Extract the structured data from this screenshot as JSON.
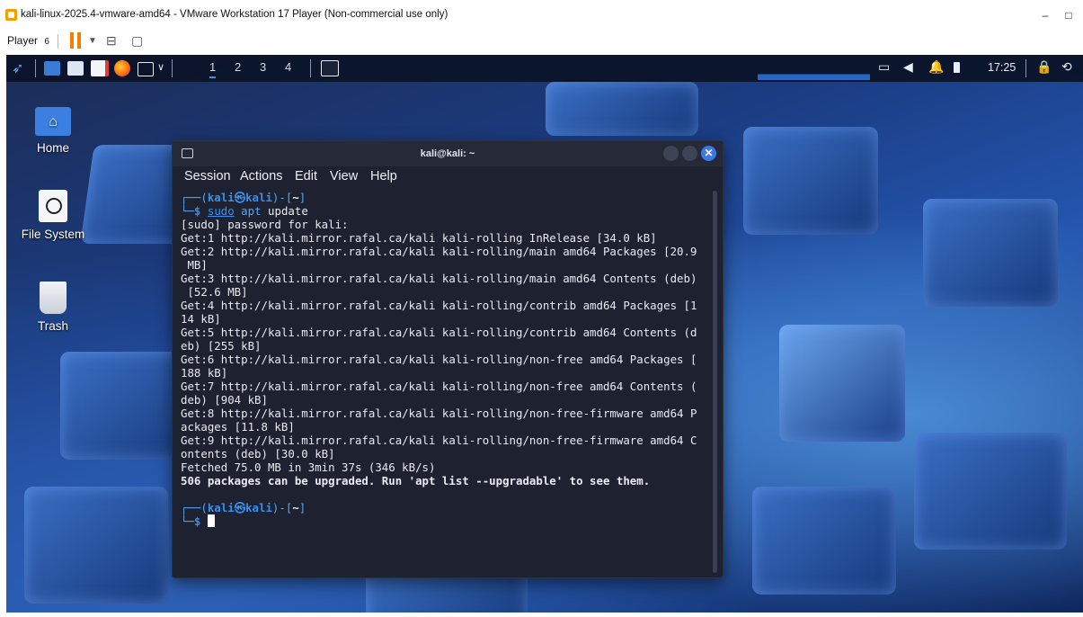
{
  "host": {
    "title": "kali-linux-2025.4-vmware-amd64 - VMware Workstation 17 Player (Non-commercial use only)",
    "minimize": "–",
    "maximize": "□"
  },
  "toolbar": {
    "player_label": "Player",
    "player_suffix": "6"
  },
  "panel": {
    "workspaces": [
      "1",
      "2",
      "3",
      "4"
    ],
    "clock": "17:25"
  },
  "desktop": {
    "icons": [
      {
        "label": "Home"
      },
      {
        "label": "File System"
      },
      {
        "label": "Trash"
      }
    ]
  },
  "terminal": {
    "title": "kali@kali: ~",
    "menu": [
      "Session",
      "Actions",
      "Edit",
      "View",
      "Help"
    ],
    "prompt_user": "kali",
    "prompt_host": "kali",
    "prompt_dir": "~",
    "command_sudo": "sudo",
    "command_apt": "apt",
    "command_rest": " update",
    "output": [
      "[sudo] password for kali:",
      "Get:1 http://kali.mirror.rafal.ca/kali kali-rolling InRelease [34.0 kB]",
      "Get:2 http://kali.mirror.rafal.ca/kali kali-rolling/main amd64 Packages [20.9",
      " MB]",
      "Get:3 http://kali.mirror.rafal.ca/kali kali-rolling/main amd64 Contents (deb)",
      " [52.6 MB]",
      "Get:4 http://kali.mirror.rafal.ca/kali kali-rolling/contrib amd64 Packages [1",
      "14 kB]",
      "Get:5 http://kali.mirror.rafal.ca/kali kali-rolling/contrib amd64 Contents (d",
      "eb) [255 kB]",
      "Get:6 http://kali.mirror.rafal.ca/kali kali-rolling/non-free amd64 Packages [",
      "188 kB]",
      "Get:7 http://kali.mirror.rafal.ca/kali kali-rolling/non-free amd64 Contents (",
      "deb) [904 kB]",
      "Get:8 http://kali.mirror.rafal.ca/kali kali-rolling/non-free-firmware amd64 P",
      "ackages [11.8 kB]",
      "Get:9 http://kali.mirror.rafal.ca/kali kali-rolling/non-free-firmware amd64 C",
      "ontents (deb) [30.0 kB]",
      "Fetched 75.0 MB in 3min 37s (346 kB/s)"
    ],
    "summary": "506 packages can be upgraded. Run 'apt list --upgradable' to see them.",
    "prompt_char": "$"
  }
}
